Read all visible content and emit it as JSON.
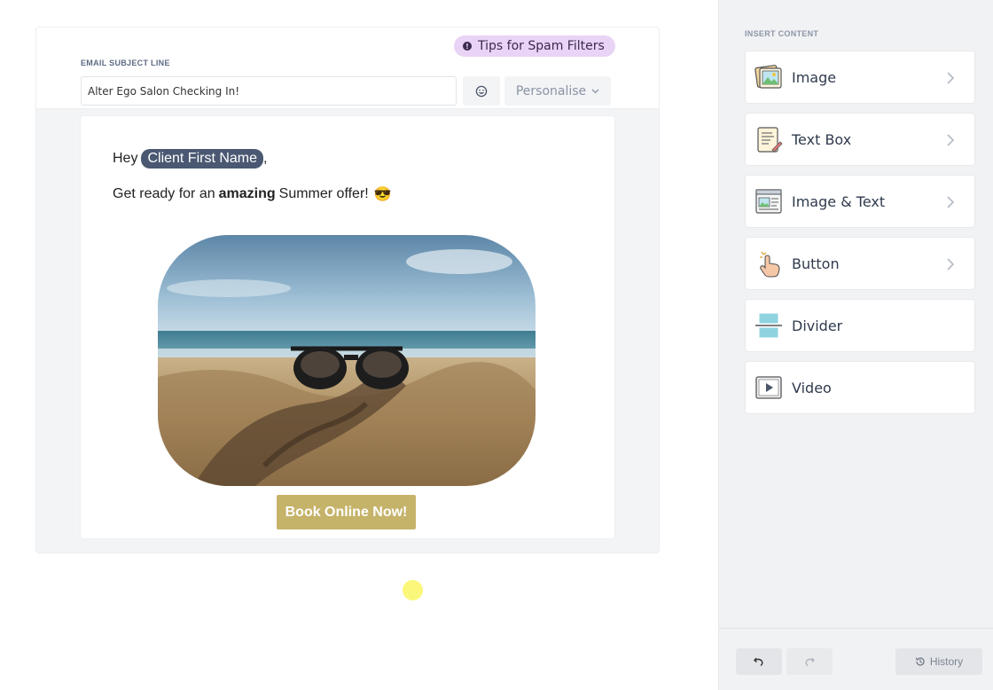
{
  "subject": {
    "tips_label": "Tips for Spam Filters",
    "label": "EMAIL SUBJECT LINE",
    "value": "Alter Ego Salon Checking In!",
    "personalise_label": "Personalise"
  },
  "email": {
    "greeting_prefix": "Hey",
    "merge_tag": "Client First Name",
    "greeting_suffix": ",",
    "offer_prefix": "Get ready for an",
    "offer_bold": "amazing",
    "offer_suffix": "Summer offer!",
    "offer_emoji": "😎",
    "button_label": "Book Online Now!"
  },
  "panel": {
    "heading": "INSERT CONTENT",
    "items": [
      {
        "label": "Image",
        "icon": "image-icon",
        "has_chevron": true
      },
      {
        "label": "Text Box",
        "icon": "text-box-icon",
        "has_chevron": true
      },
      {
        "label": "Image & Text",
        "icon": "image-text-icon",
        "has_chevron": true
      },
      {
        "label": "Button",
        "icon": "pointer-hand-icon",
        "has_chevron": true
      },
      {
        "label": "Divider",
        "icon": "divider-icon",
        "has_chevron": false
      },
      {
        "label": "Video",
        "icon": "video-icon",
        "has_chevron": false
      }
    ],
    "history_label": "History"
  },
  "colors": {
    "tips_bg": "#e9d4f5",
    "merge_tag_bg": "#4a5872",
    "button_bg": "#c6b36a",
    "panel_bg": "#f1f2f4"
  }
}
